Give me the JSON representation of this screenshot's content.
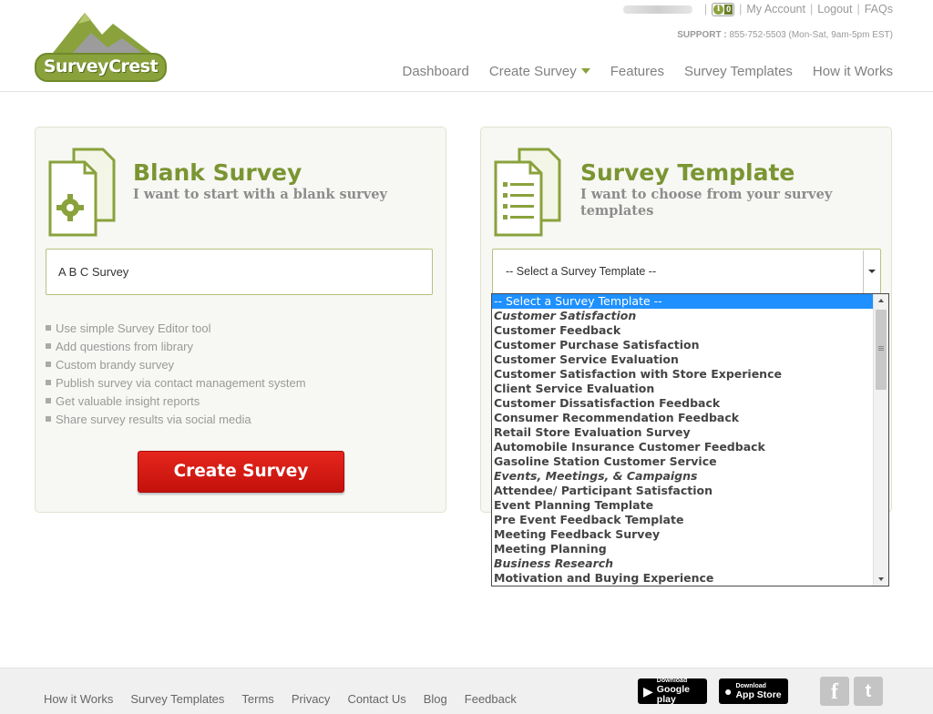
{
  "brand": {
    "logo_text": "SurveyCrest"
  },
  "userbar": {
    "info_badge_count": "0",
    "links": [
      "My Account",
      "Logout",
      "FAQs"
    ],
    "separator": "|"
  },
  "support": {
    "label": "SUPPORT :",
    "text": "855-752-5503 (Mon-Sat, 9am-5pm EST)"
  },
  "nav": [
    "Dashboard",
    "Create Survey",
    "Features",
    "Survey Templates",
    "How it Works"
  ],
  "blank_panel": {
    "title": "Blank Survey",
    "subtitle": "I want to start with a blank survey",
    "name_input_value": "A B C Survey",
    "features": [
      "Use simple Survey Editor tool",
      "Add questions from library",
      "Custom brandy survey",
      "Publish survey via contact management system",
      "Get valuable insight reports",
      "Share survey results via social media"
    ],
    "create_button": "Create Survey"
  },
  "template_panel": {
    "title": "Survey Template",
    "subtitle": "I want to choose from your survey templates",
    "select_value": "-- Select a Survey Template --"
  },
  "dropdown": {
    "options": [
      {
        "label": "-- Select a Survey Template --",
        "kind": "selected"
      },
      {
        "label": "Customer Satisfaction",
        "kind": "group"
      },
      {
        "label": "Customer Feedback",
        "kind": "option"
      },
      {
        "label": "Customer Purchase Satisfaction",
        "kind": "option"
      },
      {
        "label": "Customer Service Evaluation",
        "kind": "option"
      },
      {
        "label": "Customer Satisfaction with Store Experience",
        "kind": "option"
      },
      {
        "label": "Client Service Evaluation",
        "kind": "option"
      },
      {
        "label": "Customer Dissatisfaction Feedback",
        "kind": "option"
      },
      {
        "label": "Consumer Recommendation Feedback",
        "kind": "option"
      },
      {
        "label": "Retail Store Evaluation Survey",
        "kind": "option"
      },
      {
        "label": "Automobile Insurance Customer Feedback",
        "kind": "option"
      },
      {
        "label": "Gasoline Station Customer Service",
        "kind": "option"
      },
      {
        "label": "Events, Meetings, & Campaigns",
        "kind": "group"
      },
      {
        "label": "Attendee/ Participant Satisfaction",
        "kind": "option"
      },
      {
        "label": "Event Planning Template",
        "kind": "option"
      },
      {
        "label": "Pre Event Feedback Template",
        "kind": "option"
      },
      {
        "label": "Meeting Feedback Survey",
        "kind": "option"
      },
      {
        "label": "Meeting Planning",
        "kind": "option"
      },
      {
        "label": "Business Research",
        "kind": "group"
      },
      {
        "label": "Motivation and Buying Experience",
        "kind": "option"
      }
    ]
  },
  "footer": {
    "links": [
      "How it Works",
      "Survey Templates",
      "Terms",
      "Privacy",
      "Contact Us",
      "Blog",
      "Feedback"
    ],
    "google_play": {
      "small": "Download",
      "big": "Google play"
    },
    "app_store": {
      "small": "Download",
      "big": "App Store"
    },
    "social": {
      "facebook": "f",
      "twitter": "t"
    }
  },
  "colors": {
    "accent_green": "#7a9531",
    "button_red": "#d71b13",
    "selection_blue": "#1e90ff"
  }
}
